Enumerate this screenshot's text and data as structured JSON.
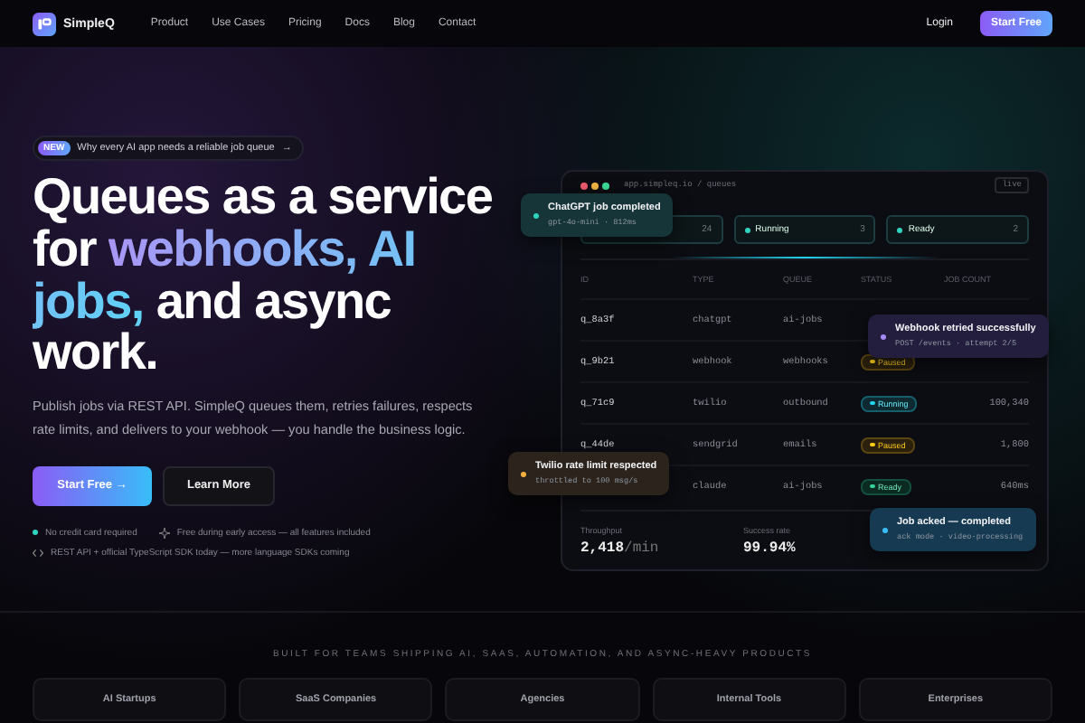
{
  "nav": {
    "brand": "SimpleQ",
    "links": [
      "Product",
      "Use Cases",
      "Pricing",
      "Docs",
      "Blog",
      "Contact"
    ],
    "login": "Login",
    "cta": "Start Free"
  },
  "hero": {
    "badge": {
      "tag": "NEW",
      "text": "Why every AI app needs a reliable job queue",
      "arrow": "→"
    },
    "headline": [
      {
        "text": "Queues as a service for ",
        "kind": "plain"
      },
      {
        "text": "webhooks, AI jobs,",
        "kind": "gradient"
      },
      {
        "text": " and async work.",
        "kind": "plain"
      }
    ],
    "lead": "Publish jobs via REST API. SimpleQ queues them, retries failures, respects rate limits, and delivers to your webhook — you handle the business logic.",
    "primary": {
      "label": "Start Free",
      "arrow": "→"
    },
    "secondary": "Learn More",
    "notes": [
      {
        "kind": "dot",
        "text": "No credit card required"
      },
      {
        "kind": "spark",
        "text": "Free during early access — all features included"
      },
      {
        "kind": "code",
        "text": "REST API + official TypeScript SDK today — more language SDKs coming"
      }
    ]
  },
  "dashboard": {
    "url": "app.simpleq.io / queues",
    "live": "live",
    "stats": [
      {
        "count": "24"
      },
      {
        "label": "Running",
        "count": "3"
      },
      {
        "label": "Ready",
        "count": "2"
      }
    ],
    "columns": [
      "ID",
      "TYPE",
      "QUEUE",
      "STATUS",
      "JOB COUNT"
    ],
    "rows": [
      {
        "id": "q_8a3f",
        "type": "chatgpt",
        "queue": "ai-jobs"
      },
      {
        "id": "q_9b21",
        "type": "webhook",
        "queue": "webhooks",
        "status": {
          "kind": "paused",
          "label": "Paused"
        }
      },
      {
        "id": "q_71c9",
        "type": "twilio",
        "queue": "outbound",
        "status": {
          "kind": "running",
          "label": "Running"
        },
        "count": "100,340"
      },
      {
        "id": "q_44de",
        "type": "sendgrid",
        "queue": "emails",
        "status": {
          "kind": "paused",
          "label": "Paused"
        },
        "count": "1,800"
      },
      {
        "type": "claude",
        "queue": "ai-jobs",
        "status": {
          "kind": "ready",
          "label": "Ready"
        },
        "count": "640ms"
      }
    ],
    "metrics": [
      {
        "label": "Throughput",
        "value": "2,418",
        "unit": "/min"
      },
      {
        "label": "Success rate",
        "value": "99.94%"
      }
    ],
    "toasts": [
      {
        "kind": "teal",
        "title": "ChatGPT job completed",
        "detail": "gpt-4o-mini · 812ms"
      },
      {
        "kind": "violet",
        "title": "Webhook retried successfully",
        "detail": "POST /events · attempt 2/5"
      },
      {
        "kind": "amber",
        "title": "Twilio rate limit respected",
        "detail": "throttled to 100 msg/s"
      },
      {
        "kind": "blue",
        "title": "Job acked — completed",
        "detail": "ack mode · video-processing"
      }
    ]
  },
  "audience": {
    "heading": "BUILT FOR TEAMS SHIPPING AI, SAAS, AUTOMATION, AND ASYNC-HEAVY PRODUCTS",
    "chips": [
      "AI Startups",
      "SaaS Companies",
      "Agencies",
      "Internal Tools",
      "Enterprises"
    ]
  }
}
